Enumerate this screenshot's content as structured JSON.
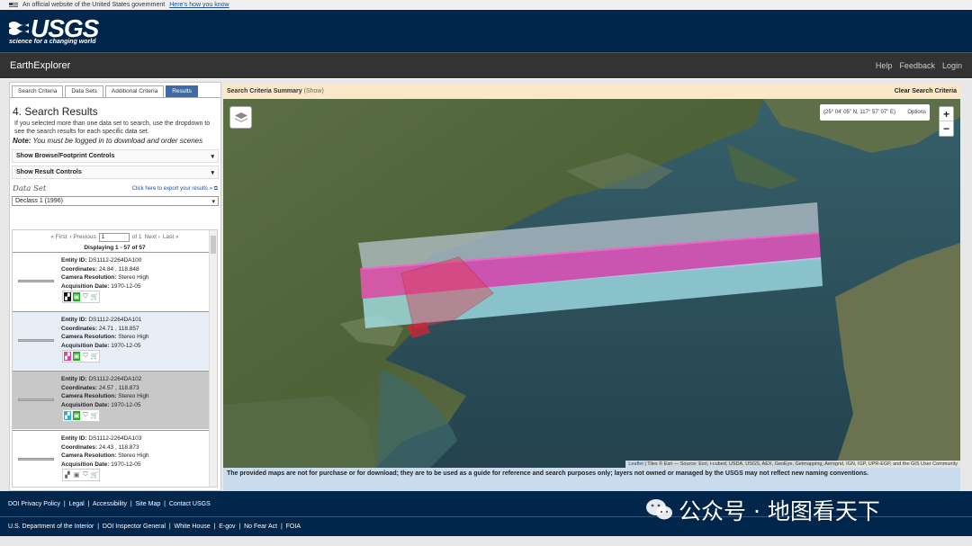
{
  "gov_banner": {
    "text": "An official website of the United States government",
    "link": "Here's how you know"
  },
  "logo": {
    "name": "USGS",
    "tagline": "science for a changing world"
  },
  "appbar": {
    "title": "EarthExplorer",
    "links": [
      "Help",
      "Feedback",
      "Login"
    ]
  },
  "tabs": [
    {
      "label": "Search Criteria",
      "active": false
    },
    {
      "label": "Data Sets",
      "active": false
    },
    {
      "label": "Additional Criteria",
      "active": false
    },
    {
      "label": "Results",
      "active": true
    }
  ],
  "sidebar": {
    "heading": "4. Search Results",
    "intro": "If you selected more than one data set to search, use the dropdown to see the search results for each specific data set.",
    "note_label": "Note:",
    "note": " You must be logged in to download and order scenes",
    "browse_controls": "Show Browse/Footprint Controls",
    "result_controls": "Show Result Controls",
    "dataset_label": "Data Set",
    "export_link": "Click here to export your results »",
    "dataset_selected": "Declass 1 (1996)"
  },
  "pager": {
    "first": "« First",
    "previous": "‹ Previous",
    "page": "1",
    "of": "of 1",
    "next": "Next ›",
    "last": "Last »",
    "displaying": "Displaying 1 - 57 of 57"
  },
  "results": [
    {
      "entity_id": "DS1112-2264DA100",
      "coordinates": "24.84 , 118.848",
      "resolution": "Stereo High",
      "date": "1970-12-05",
      "footprint": "dark"
    },
    {
      "entity_id": "DS1112-2264DA101",
      "coordinates": "24.71 , 118.857",
      "resolution": "Stereo High",
      "date": "1970-12-05",
      "footprint": "pink"
    },
    {
      "entity_id": "DS1112-2264DA102",
      "coordinates": "24.57 , 118.873",
      "resolution": "Stereo High",
      "date": "1970-12-05",
      "footprint": "teal"
    },
    {
      "entity_id": "DS1112-2264DA103",
      "coordinates": "24.43 , 118.873",
      "resolution": "Stereo High",
      "date": "1970-12-05",
      "footprint": "plain"
    }
  ],
  "labels": {
    "entity_id": "Entity ID:",
    "coordinates": "Coordinates:",
    "resolution": "Camera Resolution:",
    "date": "Acquisition Date:"
  },
  "criteria": {
    "label": "Search Criteria Summary",
    "show": "(Show)",
    "clear": "Clear Search Criteria"
  },
  "map": {
    "coords": "(25° 04' 05\" N, 117° 57' 07\" E)",
    "options": "Options",
    "zoom_in": "+",
    "zoom_out": "−",
    "attribution_link": "Leaflet",
    "attribution": " | Tiles © Esri — Source: Esri, i-cubed, USDA, USGS, AEX, GeoEye, Getmapping, Aerogrid, IGN, IGP, UPR-EGP, and the GIS User Community"
  },
  "disclaimer": "The provided maps are not for purchase or for download; they are to be used as a guide for reference and search purposes only; layers not owned or managed by the USGS may not reflect new naming conventions.",
  "footer1": "DOI Privacy Policy  |  Legal  |  Accessibility  |  Site Map  |  Contact USGS",
  "footer2": "U.S. Department of the Interior  |  DOI Inspector General  |  White House  |  E-gov  |  No Fear Act  |  FOIA",
  "watermark": "公众号 · 地图看天下",
  "colors": {
    "header": "#00264c",
    "appbar": "#333333",
    "tab_active": "#3e6aa8",
    "criteria_bg": "#fbe8c8",
    "disclaimer_bg": "#c8dcee"
  }
}
